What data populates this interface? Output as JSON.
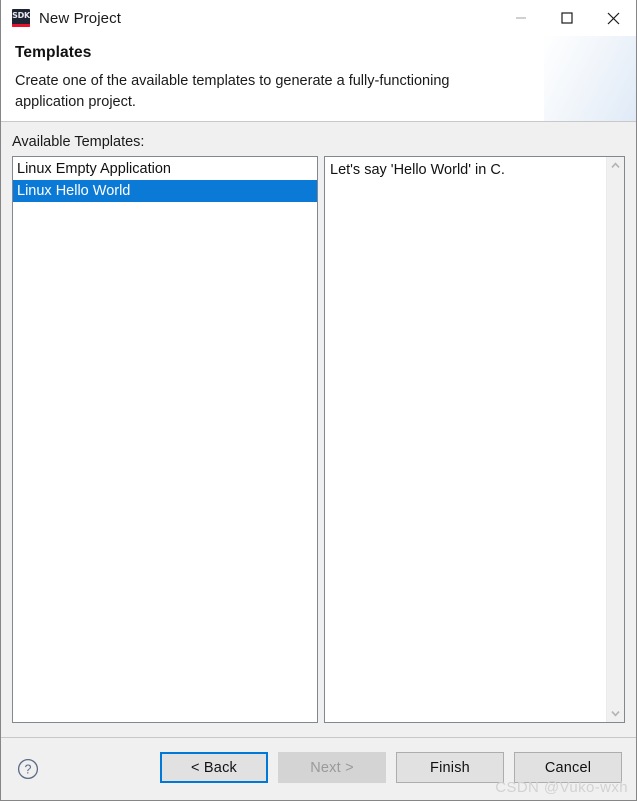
{
  "window": {
    "title": "New Project",
    "app_icon_label": "SDK",
    "controls": {
      "minimize": "minimize-icon",
      "maximize": "maximize-icon",
      "close": "close-icon"
    }
  },
  "header": {
    "title": "Templates",
    "description": "Create one of the available templates to generate a fully-functioning application project.",
    "banner_icon": "open-folder-c-icon"
  },
  "main": {
    "list_label": "Available Templates:",
    "templates": [
      {
        "label": "Linux Empty Application",
        "selected": false
      },
      {
        "label": "Linux Hello World",
        "selected": true
      }
    ],
    "description_text": "Let's say 'Hello World' in C.",
    "scrollbar": {
      "up_arrow": "chevron-up-icon",
      "down_arrow": "chevron-down-icon"
    }
  },
  "footer": {
    "help_icon": "help-question-icon",
    "buttons": [
      {
        "label": "< Back",
        "state": "focused"
      },
      {
        "label": "Next >",
        "state": "disabled"
      },
      {
        "label": "Finish",
        "state": "normal"
      },
      {
        "label": "Cancel",
        "state": "normal"
      }
    ],
    "watermark": "CSDN @Vuko-wxh"
  },
  "colors": {
    "selection_blue": "#0b7ad6",
    "focus_blue": "#0078d7",
    "accent_red": "#e8112d",
    "dialog_gray": "#f0f0f0"
  }
}
